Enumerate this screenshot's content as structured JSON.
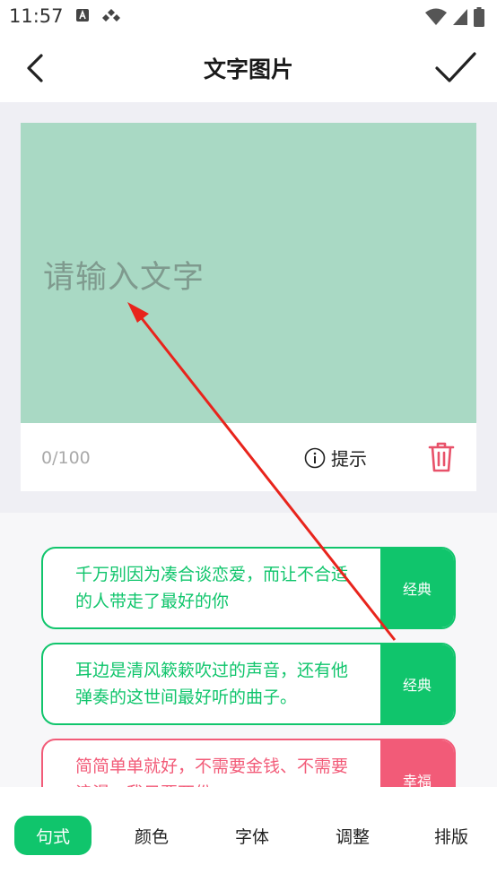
{
  "status_bar": {
    "time": "11:57"
  },
  "app_bar": {
    "title": "文字图片"
  },
  "editor": {
    "placeholder": "请输入文字",
    "char_count": "0/100",
    "hint_label": "提示",
    "canvas_color": "#a9d9c4"
  },
  "quotes": [
    {
      "text": "千万别因为凑合谈恋爱，而让不合适的人带走了最好的你",
      "tag": "经典",
      "color": "#10c56c"
    },
    {
      "text": "耳边是清风簌簌吹过的声音，还有他弹奏的这世间最好听的曲子。",
      "tag": "经典",
      "color": "#10c56c"
    },
    {
      "text": "简简单单就好，不需要金钱、不需要浪漫，我只要两份",
      "tag": "幸福",
      "color": "#f25b78"
    }
  ],
  "tabs": [
    {
      "label": "句式",
      "active": true
    },
    {
      "label": "颜色",
      "active": false
    },
    {
      "label": "字体",
      "active": false
    },
    {
      "label": "调整",
      "active": false
    },
    {
      "label": "排版",
      "active": false
    }
  ],
  "colors": {
    "accent": "#10c56c",
    "danger": "#e8526a",
    "arrow": "#e8241c"
  }
}
